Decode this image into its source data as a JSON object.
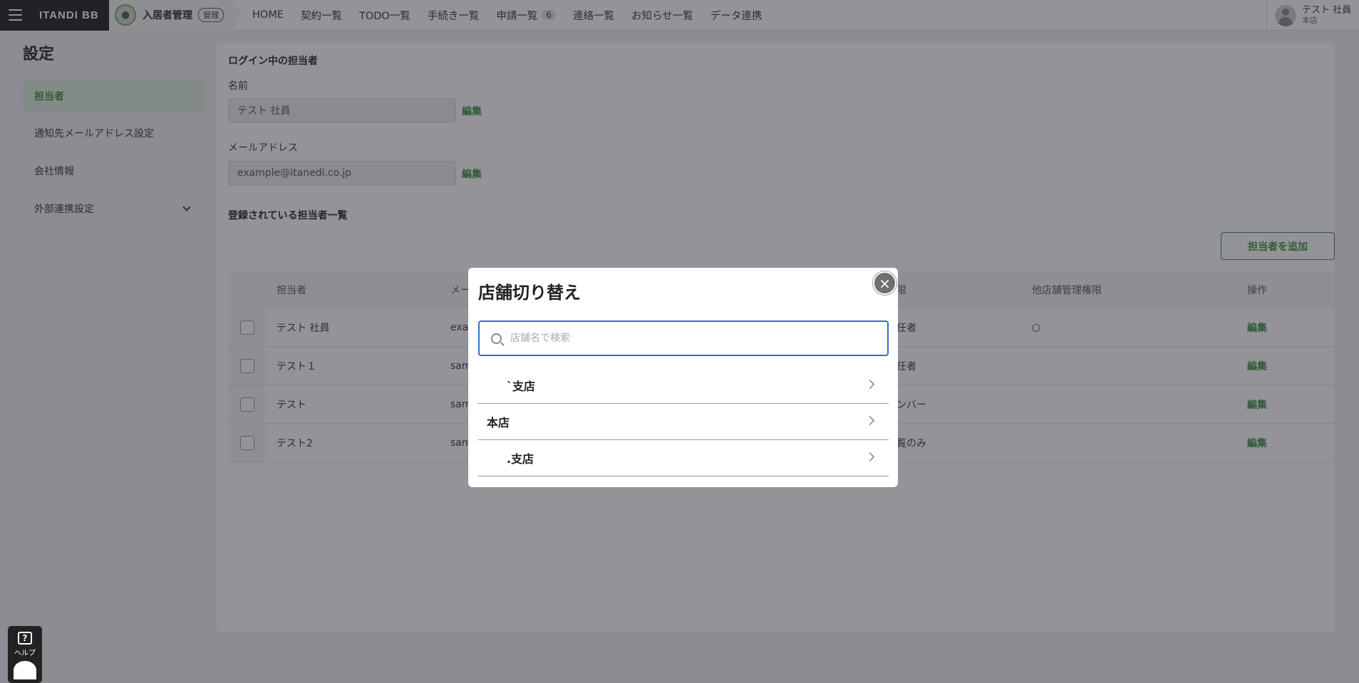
{
  "app": {
    "logo": "ITANDI BB",
    "product": "入居者管理",
    "product_tag": "管理"
  },
  "nav": [
    {
      "label": "HOME"
    },
    {
      "label": "契約一覧"
    },
    {
      "label": "TODO一覧"
    },
    {
      "label": "手続き一覧"
    },
    {
      "label": "申請一覧",
      "badge": "6"
    },
    {
      "label": "連絡一覧"
    },
    {
      "label": "お知らせ一覧"
    },
    {
      "label": "データ連携"
    }
  ],
  "user": {
    "name": "テスト 社員",
    "store": "本店"
  },
  "sidebar": {
    "title": "設定",
    "items": [
      {
        "label": "担当者"
      },
      {
        "label": "通知先メールアドレス設定"
      },
      {
        "label": "会社情報"
      },
      {
        "label": "外部連携設定"
      }
    ]
  },
  "main": {
    "login_section_title": "ログイン中の担当者",
    "name_label": "名前",
    "name_value": "テスト 社員",
    "email_label": "メールアドレス",
    "email_value": "example@itanedi.co.jp",
    "edit_label": "編集",
    "list_title": "登録されている担当者一覧",
    "add_button": "担当者を追加"
  },
  "table": {
    "headers": [
      "担当者",
      "メー",
      "限",
      "他店舗管理権限",
      "操作"
    ],
    "rows": [
      {
        "name": "テスト 社員",
        "email": "exa",
        "role": "任者",
        "other": "○",
        "op": "編集"
      },
      {
        "name": "テスト１",
        "email": "sam",
        "role": "任者",
        "other": "",
        "op": "編集"
      },
      {
        "name": "テスト",
        "email": "sam",
        "role": "ンバー",
        "other": "",
        "op": "編集"
      },
      {
        "name": "テスト2",
        "email": "sam",
        "role": "覧のみ",
        "other": "",
        "op": "編集"
      }
    ]
  },
  "help": {
    "label": "ヘルプ",
    "icon": "question-icon"
  },
  "modal": {
    "title": "店舗切り替え",
    "search_placeholder": "店舗名で検索",
    "stores": [
      {
        "label": "`支店"
      },
      {
        "label": "本店"
      },
      {
        "label": ".支店"
      }
    ]
  }
}
